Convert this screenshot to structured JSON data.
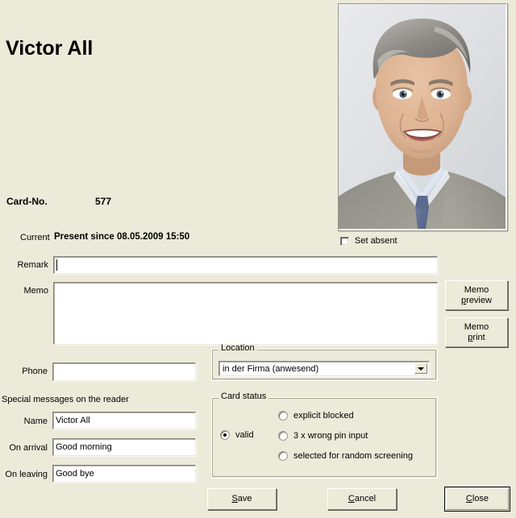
{
  "window": {
    "background": "#ecead9"
  },
  "person": {
    "name": "Victor All",
    "photo_alt": "portrait-photo"
  },
  "card": {
    "label": "Card-No.",
    "number": "577"
  },
  "status": {
    "current_label": "Current",
    "current_value": "Present since 08.05.2009 15:50",
    "set_absent_label": "Set absent",
    "set_absent_checked": false
  },
  "fields": {
    "remark": {
      "label": "Remark",
      "value": "",
      "placeholder": ""
    },
    "memo": {
      "label": "Memo",
      "value": "",
      "placeholder": ""
    },
    "phone": {
      "label": "Phone",
      "value": "",
      "placeholder": ""
    }
  },
  "memo_buttons": {
    "preview_line1": "Memo",
    "preview_line2_accel": "p",
    "preview_line2_rest": "review",
    "print_line1": "Memo",
    "print_line2_accel": "p",
    "print_line2_rest": "rint"
  },
  "location": {
    "group_title": "Location",
    "selected": "in der Firma (anwesend)",
    "options": [
      "in der Firma (anwesend)"
    ]
  },
  "card_status": {
    "group_title": "Card status",
    "selected": "valid",
    "options": [
      {
        "id": "valid",
        "label": "valid",
        "checked": true
      },
      {
        "id": "explicit-blocked",
        "label": "explicit blocked",
        "checked": false
      },
      {
        "id": "wrong-pin",
        "label": "3 x wrong pin input",
        "checked": false
      },
      {
        "id": "random-screening",
        "label": "selected for random screening",
        "checked": false
      }
    ]
  },
  "special_messages": {
    "section_title": "Special messages on the reader",
    "name": {
      "label": "Name",
      "value": "Victor All"
    },
    "on_arrival": {
      "label": "On arrival",
      "value": "Good morning"
    },
    "on_leaving": {
      "label": "On leaving",
      "value": "Good bye"
    }
  },
  "actions": {
    "save": {
      "accel": "S",
      "rest": "ave"
    },
    "cancel": {
      "accel": "C",
      "rest": "ancel"
    },
    "close": {
      "accel": "C",
      "rest": "lose"
    }
  }
}
